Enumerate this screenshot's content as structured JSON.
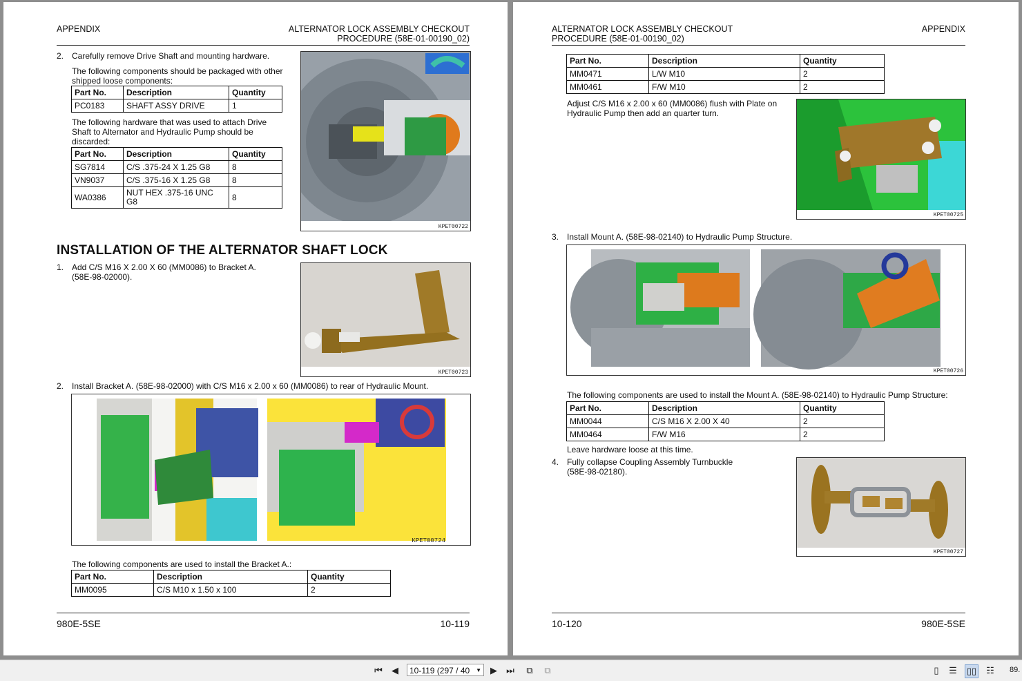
{
  "left_page": {
    "header_left": "APPENDIX",
    "header_right_line1": "ALTERNATOR LOCK ASSEMBLY CHECKOUT",
    "header_right_line2": "PROCEDURE (58E-01-00190_02)",
    "step2_num": "2.",
    "step2_text": "Carefully remove Drive Shaft and mounting hardware.",
    "packaged_text": "The following components should be packaged with other shipped loose components:",
    "table1": {
      "headers": [
        "Part No.",
        "Description",
        "Quantity"
      ],
      "rows": [
        [
          "PC0183",
          "SHAFT ASSY DRIVE",
          "1"
        ]
      ]
    },
    "discard_text": "The following hardware that was used to attach Drive Shaft to Alternator and Hydraulic Pump should be discarded:",
    "table2": {
      "headers": [
        "Part No.",
        "Description",
        "Quantity"
      ],
      "rows": [
        [
          "SG7814",
          "C/S .375-24 X 1.25 G8",
          "8"
        ],
        [
          "VN9037",
          "C/S .375-16 X 1.25 G8",
          "8"
        ],
        [
          "WA0386",
          "NUT HEX .375-16 UNC G8",
          "8"
        ]
      ]
    },
    "fig1_caption": "KPET00722",
    "section_title": "INSTALLATION OF THE ALTERNATOR SHAFT LOCK",
    "inst1_num": "1.",
    "inst1_text": "Add C/S M16 X 2.00 X 60 (MM0086) to Bracket A. (58E-98-02000).",
    "fig2_caption": "KPET00723",
    "inst2_num": "2.",
    "inst2_text": "Install Bracket A. (58E-98-02000) with C/S M16 x 2.00 x 60 (MM0086) to rear of Hydraulic Mount.",
    "fig3_caption": "KPET00724",
    "bracket_text": "The following components are used to install the Bracket A.:",
    "table3": {
      "headers": [
        "Part No.",
        "Description",
        "Quantity"
      ],
      "rows": [
        [
          "MM0095",
          "C/S M10 x 1.50 x 100",
          "2"
        ]
      ]
    },
    "footer_left": "980E-5SE",
    "footer_right": "10-119"
  },
  "right_page": {
    "header_left_line1": "ALTERNATOR LOCK ASSEMBLY CHECKOUT",
    "header_left_line2": "PROCEDURE (58E-01-00190_02)",
    "header_right": "APPENDIX",
    "table4": {
      "headers": [
        "Part No.",
        "Description",
        "Quantity"
      ],
      "rows": [
        [
          "MM0471",
          "L/W M10",
          "2"
        ],
        [
          "MM0461",
          "F/W M10",
          "2"
        ]
      ]
    },
    "adjust_text": "Adjust C/S M16 x 2.00 x 60 (MM0086) flush with Plate on Hydraulic Pump then add an quarter turn.",
    "fig4_caption": "KPET00725",
    "step3_num": "3.",
    "step3_text": "Install Mount A. (58E-98-02140) to Hydraulic Pump Structure.",
    "fig5_caption": "KPET00726",
    "mount_text": "The following components are used to install the Mount A. (58E-98-02140) to Hydraulic Pump Structure:",
    "table5": {
      "headers": [
        "Part No.",
        "Description",
        "Quantity"
      ],
      "rows": [
        [
          "MM0044",
          "C/S M16 X 2.00 X 40",
          "2"
        ],
        [
          "MM0464",
          "F/W M16",
          "2"
        ]
      ]
    },
    "loose_text": "Leave hardware loose at this time.",
    "step4_num": "4.",
    "step4_text": "Fully collapse Coupling Assembly Turnbuckle (58E-98-02180).",
    "fig6_caption": "KPET00727",
    "footer_left": "10-120",
    "footer_right": "980E-5SE"
  },
  "toolbar": {
    "page_value": "10-119 (297 / 40",
    "zoom": "89."
  }
}
